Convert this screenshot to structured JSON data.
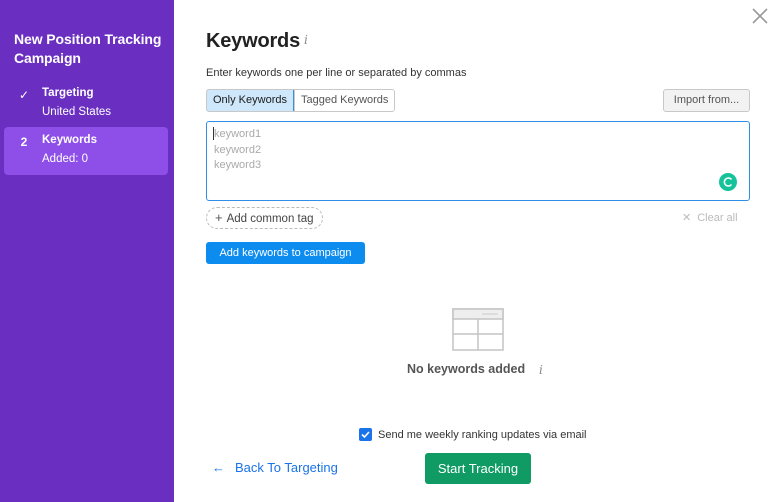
{
  "sidebar": {
    "title": "New Position Tracking Campaign",
    "steps": [
      {
        "marker": "✓",
        "name": "Targeting",
        "sub": "United States"
      },
      {
        "marker": "2",
        "name": "Keywords",
        "sub": "Added: 0"
      }
    ]
  },
  "header": {
    "title": "Keywords",
    "info_icon": "info-icon",
    "close_icon": "close-icon"
  },
  "form": {
    "instruction": "Enter keywords one per line or separated by commas",
    "toggle": [
      "Only Keywords",
      "Tagged Keywords"
    ],
    "import_label": "Import from...",
    "placeholder_lines": [
      "keyword1",
      "keyword2",
      "keyword3"
    ],
    "add_tag_label": "Add common tag",
    "clear_all_label": "Clear all",
    "add_button_label": "Add keywords to campaign"
  },
  "empty_state": {
    "text": "No keywords added",
    "icon": "table-icon"
  },
  "footer": {
    "email_label": "Send me weekly ranking updates via email",
    "email_checked": true,
    "back_label": "Back To Targeting",
    "start_label": "Start Tracking"
  },
  "colors": {
    "sidebar": "#6a2fc0",
    "active_step": "#8d4fe8",
    "primary_blue": "#0d8cf0",
    "start_green": "#109b64"
  }
}
